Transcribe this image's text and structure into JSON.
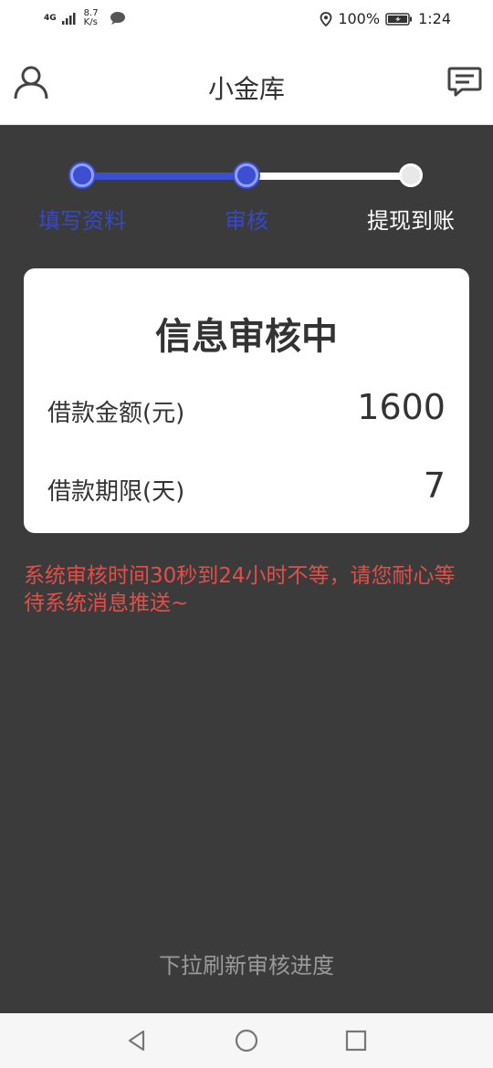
{
  "status_bar": {
    "network": "4G",
    "net_speed_value": "8.7",
    "net_speed_unit": "K/s",
    "battery": "100%",
    "time": "1:24"
  },
  "header": {
    "title": "小金库"
  },
  "steps": [
    {
      "label": "填写资料",
      "state": "done"
    },
    {
      "label": "审核",
      "state": "done"
    },
    {
      "label": "提现到账",
      "state": "todo"
    }
  ],
  "card": {
    "title": "信息审核中",
    "amount_label": "借款金额(元)",
    "amount_value": "1600",
    "term_label": "借款期限(天)",
    "term_value": "7"
  },
  "notice": "系统审核时间30秒到24小时不等，请您耐心等待系统消息推送~",
  "refresh_hint": "下拉刷新审核进度",
  "colors": {
    "accent": "#3b4fd0",
    "background": "#3b3b3b",
    "notice": "#e0504a"
  }
}
